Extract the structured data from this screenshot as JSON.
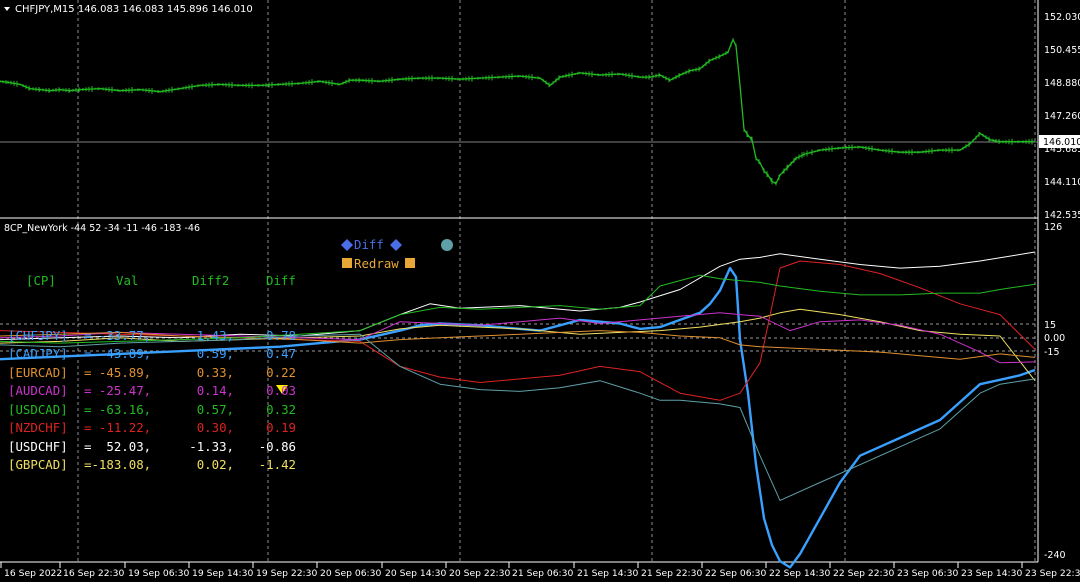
{
  "main_chart": {
    "header": "CHFJPY,M15 146.083 146.083 145.896 146.010",
    "current_price": "146.010",
    "price_labels": [
      "152.030",
      "150.455",
      "148.880",
      "147.260",
      "145.685",
      "144.110",
      "142.535"
    ],
    "line_color": "#22bb22"
  },
  "indicator": {
    "header": "8CP_NewYork -44 52 -34 -11 -46 -183 -46",
    "axis_labels": [
      "126",
      "15",
      "0.00",
      "-15",
      "-240"
    ],
    "table_header": [
      "[CP]",
      "Val",
      "Diff2",
      "Diff"
    ],
    "table_header_color": "#22bb22",
    "rows": [
      {
        "pair": "[CHFJPY]",
        "val": "= -33.77,",
        "diff2": "1.43,",
        "diff": "0.78",
        "color": "#3aa0ff"
      },
      {
        "pair": "[CADJPY]",
        "val": "= -43.89,",
        "diff2": "0.59,",
        "diff": "0.47",
        "color": "#3aa0ff"
      },
      {
        "pair": "[EURCAD]",
        "val": "= -45.89,",
        "diff2": "0.33,",
        "diff": "0.22",
        "color": "#e09030"
      },
      {
        "pair": "[AUDCAD]",
        "val": "= -25.47,",
        "diff2": "0.14,",
        "diff": "0.03",
        "color": "#cc33cc"
      },
      {
        "pair": "[USDCAD]",
        "val": "= -63.16,",
        "diff2": "0.57,",
        "diff": "0.32",
        "color": "#22bb22"
      },
      {
        "pair": "[NZDCHF]",
        "val": "= -11.22,",
        "diff2": "0.30,",
        "diff": "0.19",
        "color": "#dd2222"
      },
      {
        "pair": "[USDCHF]",
        "val": "=  52.03,",
        "diff2": "-1.33,",
        "diff": "-0.86",
        "color": "#ffffff"
      },
      {
        "pair": "[GBPCAD]",
        "val": "=-183.08,",
        "diff2": "0.02,",
        "diff": "-1.42",
        "color": "#f0e060"
      }
    ],
    "diff_button": "Diff",
    "redraw_button": "Redraw",
    "diff_button_color": "#4a6ee8",
    "redraw_button_color": "#e8a838",
    "dot_color": "#5fa0a8",
    "marker_color": "#ffee00"
  },
  "time_axis": [
    "16 Sep 2022",
    "16 Sep 22:30",
    "19 Sep 06:30",
    "19 Sep 14:30",
    "19 Sep 22:30",
    "20 Sep 06:30",
    "20 Sep 14:30",
    "20 Sep 22:30",
    "21 Sep 06:30",
    "21 Sep 14:30",
    "21 Sep 22:30",
    "22 Sep 06:30",
    "22 Sep 14:30",
    "22 Sep 22:30",
    "23 Sep 06:30",
    "23 Sep 14:30",
    "23 Sep 22:30"
  ],
  "chart_data": {
    "type": "line",
    "main_price_series": {
      "x": [
        0,
        8,
        20,
        30,
        40,
        50,
        60,
        70,
        80,
        100,
        120,
        140,
        160,
        180,
        200,
        220,
        240,
        260,
        280,
        300,
        320,
        340,
        350,
        360,
        380,
        400,
        420,
        440,
        460,
        480,
        500,
        520,
        540,
        550,
        560,
        580,
        600,
        620,
        640,
        650,
        660,
        670,
        680,
        690,
        700,
        710,
        720,
        728,
        733,
        736,
        740,
        744,
        748,
        752,
        756,
        760,
        764,
        768,
        772,
        776,
        780,
        784,
        788,
        796,
        804,
        812,
        820,
        840,
        860,
        880,
        900,
        920,
        940,
        960,
        970,
        980,
        990,
        1000,
        1020,
        1035
      ],
      "y": [
        148.9,
        148.85,
        148.75,
        148.55,
        148.5,
        148.45,
        148.5,
        148.45,
        148.5,
        148.55,
        148.45,
        148.5,
        148.4,
        148.55,
        148.7,
        148.75,
        148.7,
        148.7,
        148.75,
        148.8,
        148.9,
        148.75,
        148.95,
        148.95,
        148.9,
        149.0,
        149.05,
        149.05,
        149.0,
        149.05,
        149.1,
        149.15,
        149.05,
        148.7,
        149.1,
        149.3,
        149.2,
        149.25,
        149.1,
        149.1,
        149.2,
        148.95,
        149.2,
        149.4,
        149.5,
        149.9,
        150.1,
        150.3,
        150.9,
        150.6,
        148.7,
        146.6,
        146.3,
        146.1,
        145.2,
        145.0,
        144.6,
        144.4,
        144.1,
        144.0,
        144.4,
        144.6,
        144.8,
        145.2,
        145.4,
        145.5,
        145.6,
        145.7,
        145.75,
        145.6,
        145.5,
        145.5,
        145.6,
        145.6,
        145.9,
        146.4,
        146.1,
        146.0,
        146.0,
        146.01
      ]
    },
    "indicator_series": [
      {
        "values_x": [
          0,
          40,
          80,
          120,
          160,
          200,
          240,
          280,
          320,
          360,
          400,
          420,
          440,
          480,
          520,
          540,
          560,
          580,
          600,
          620,
          640,
          660,
          680,
          700,
          710,
          720,
          730,
          736,
          740,
          748,
          756,
          764,
          772,
          780,
          790,
          800,
          820,
          840,
          860,
          880,
          900,
          920,
          940,
          960,
          980,
          1000,
          1020,
          1035
        ],
        "values_y": [
          -22,
          -20,
          -18,
          -16,
          -14,
          -12,
          -10,
          -8,
          -4,
          0,
          10,
          16,
          18,
          16,
          12,
          10,
          16,
          22,
          20,
          18,
          12,
          14,
          22,
          30,
          40,
          55,
          80,
          70,
          0,
          -60,
          -140,
          -200,
          -230,
          -248,
          -255,
          -240,
          -200,
          -160,
          -130,
          -120,
          -110,
          -100,
          -90,
          -70,
          -50,
          -45,
          -40,
          -34
        ],
        "color": "#3aa0ff"
      },
      {
        "values_x": [
          0,
          60,
          120,
          180,
          240,
          300,
          360,
          400,
          430,
          460,
          520,
          580,
          620,
          640,
          680,
          720,
          740,
          760,
          780,
          820,
          860,
          900,
          940,
          980,
          1035
        ],
        "values_y": [
          0,
          2,
          4,
          2,
          6,
          4,
          10,
          28,
          40,
          35,
          38,
          32,
          36,
          42,
          56,
          82,
          90,
          92,
          96,
          90,
          84,
          80,
          82,
          88,
          98
        ],
        "color": "#ffffff"
      },
      {
        "values_x": [
          0,
          60,
          120,
          180,
          240,
          300,
          360,
          400,
          440,
          480,
          520,
          580,
          620,
          660,
          700,
          740,
          760,
          780,
          800,
          840,
          880,
          920,
          960,
          1000,
          1035
        ],
        "values_y": [
          -4,
          -2,
          2,
          -2,
          0,
          2,
          4,
          12,
          16,
          14,
          12,
          6,
          8,
          10,
          14,
          20,
          24,
          30,
          34,
          28,
          20,
          10,
          6,
          4,
          -46
        ],
        "color": "#f0e060"
      },
      {
        "values_x": [
          0,
          60,
          120,
          180,
          240,
          300,
          360,
          400,
          440,
          480,
          520,
          560,
          600,
          640,
          680,
          720,
          740,
          760,
          780,
          800,
          840,
          880,
          920,
          960,
          1000,
          1035
        ],
        "values_y": [
          10,
          8,
          6,
          4,
          2,
          0,
          -2,
          -30,
          -42,
          -48,
          -44,
          -40,
          -30,
          -36,
          -60,
          -68,
          -60,
          -26,
          80,
          88,
          84,
          74,
          58,
          40,
          28,
          -11
        ],
        "color": "#dd2222"
      },
      {
        "values_x": [
          0,
          60,
          120,
          180,
          240,
          300,
          360,
          400,
          440,
          480,
          520,
          560,
          600,
          640,
          680,
          720,
          740,
          760,
          790,
          820,
          860,
          900,
          940,
          980,
          1000,
          1035
        ],
        "values_y": [
          2,
          4,
          8,
          6,
          4,
          2,
          0,
          20,
          18,
          16,
          20,
          24,
          18,
          22,
          26,
          30,
          28,
          26,
          10,
          20,
          22,
          16,
          6,
          -14,
          -26,
          -25
        ],
        "color": "#cc33cc"
      },
      {
        "values_x": [
          0,
          60,
          120,
          180,
          240,
          300,
          360,
          400,
          440,
          480,
          520,
          560,
          600,
          640,
          680,
          720,
          740,
          760,
          800,
          840,
          880,
          920,
          960,
          1000,
          1035
        ],
        "values_y": [
          4,
          6,
          8,
          4,
          2,
          0,
          -4,
          0,
          2,
          4,
          6,
          8,
          10,
          8,
          4,
          2,
          -6,
          -8,
          -10,
          -12,
          -14,
          -18,
          -22,
          -16,
          -20
        ],
        "color": "#e09030"
      },
      {
        "values_x": [
          0,
          60,
          120,
          180,
          240,
          300,
          360,
          400,
          440,
          480,
          520,
          560,
          600,
          640,
          660,
          680,
          720,
          740,
          760,
          780,
          820,
          860,
          900,
          940,
          980,
          1000,
          1035
        ],
        "values_y": [
          -6,
          -8,
          -4,
          -2,
          0,
          4,
          6,
          -30,
          -50,
          -56,
          -58,
          -54,
          -46,
          -60,
          -68,
          -68,
          -72,
          -76,
          -130,
          -180,
          -160,
          -140,
          -120,
          -100,
          -60,
          -50,
          -44
        ],
        "color": "#5fa0a8"
      },
      {
        "values_x": [
          0,
          60,
          120,
          180,
          240,
          300,
          360,
          400,
          440,
          480,
          520,
          560,
          600,
          640,
          660,
          680,
          700,
          720,
          740,
          760,
          780,
          820,
          860,
          900,
          940,
          980,
          1000,
          1035
        ],
        "values_y": [
          -2,
          -4,
          -2,
          0,
          2,
          6,
          10,
          28,
          36,
          34,
          36,
          38,
          34,
          38,
          60,
          66,
          72,
          68,
          66,
          64,
          60,
          54,
          50,
          50,
          52,
          52,
          56,
          62
        ],
        "color": "#22bb22"
      }
    ]
  }
}
